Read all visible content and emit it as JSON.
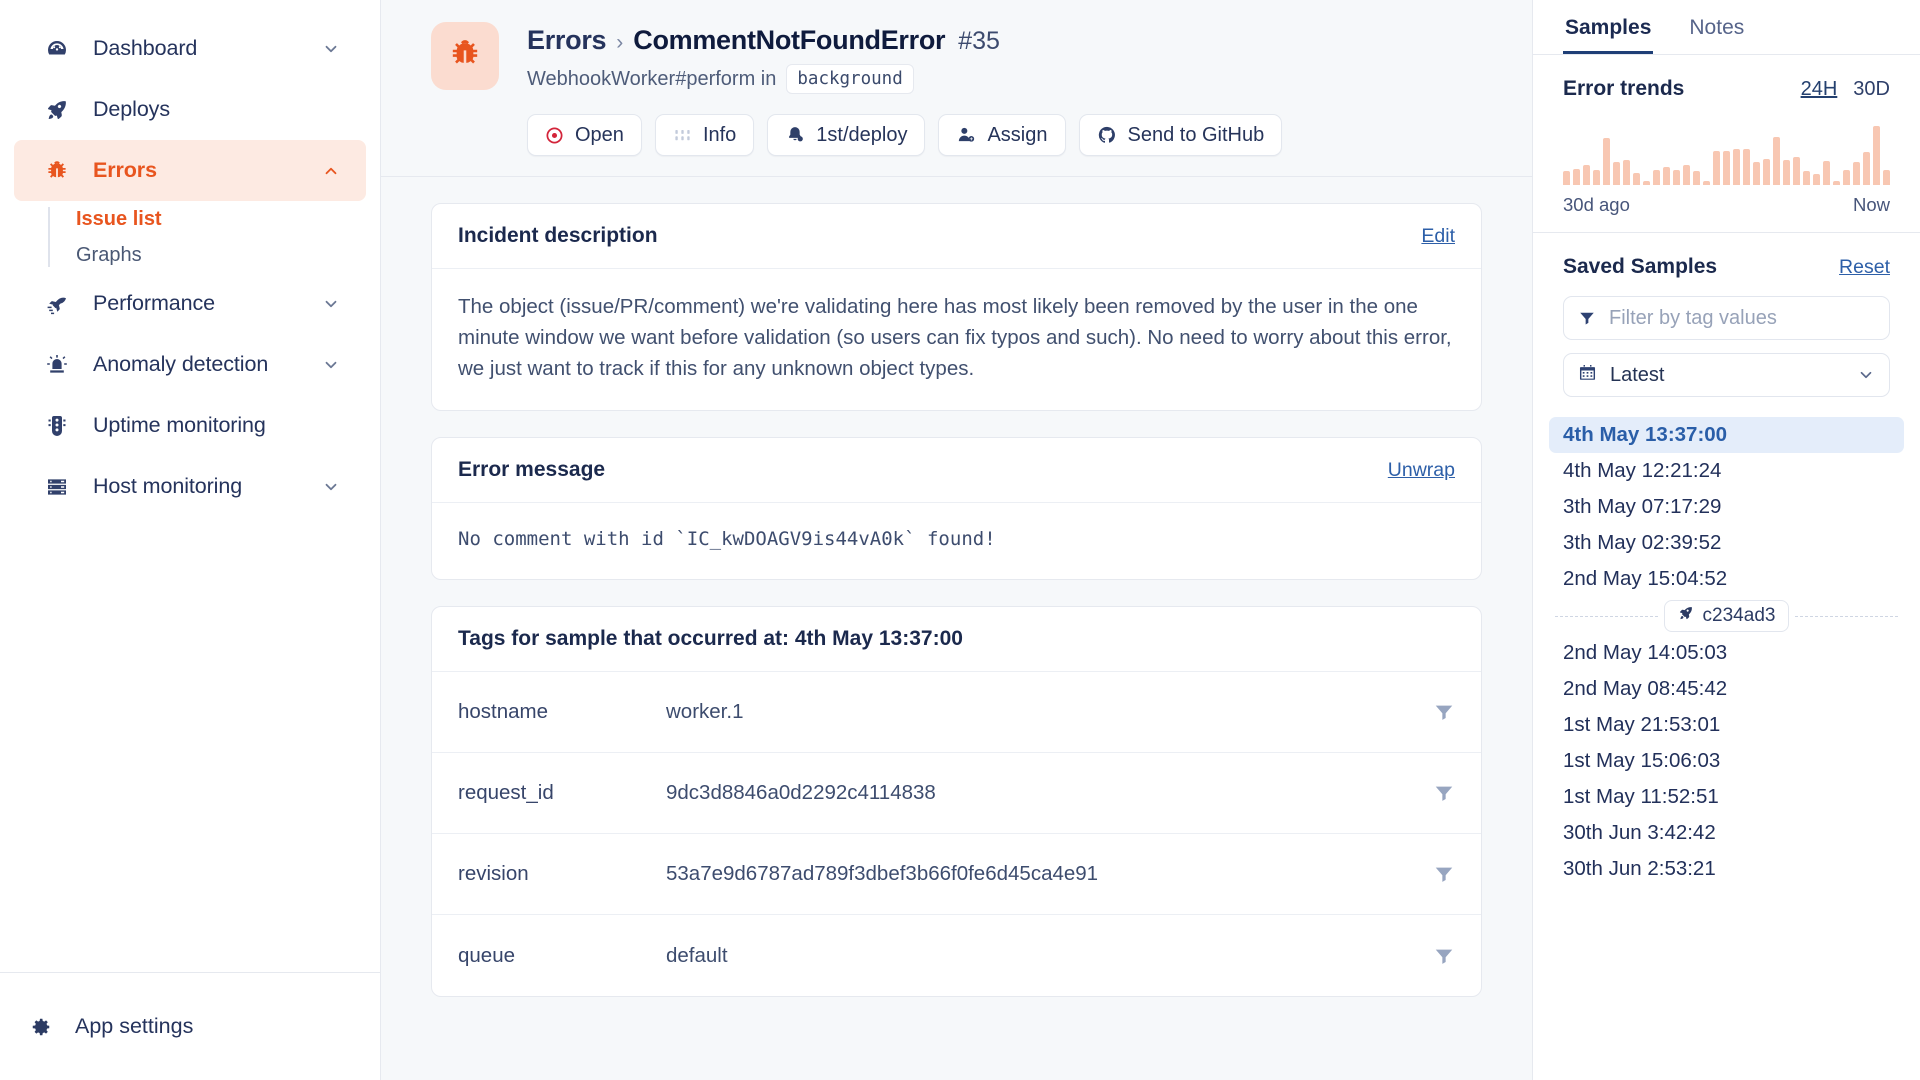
{
  "sidebar": {
    "items": [
      {
        "label": "Dashboard",
        "icon": "gauge-icon",
        "chevron": "down",
        "active": false
      },
      {
        "label": "Deploys",
        "icon": "rocket-icon",
        "chevron": "none",
        "active": false
      },
      {
        "label": "Errors",
        "icon": "bug-icon",
        "chevron": "up",
        "active": true
      },
      {
        "label": "Performance",
        "icon": "speed-icon",
        "chevron": "down",
        "active": false
      },
      {
        "label": "Anomaly detection",
        "icon": "siren-icon",
        "chevron": "down",
        "active": false
      },
      {
        "label": "Uptime monitoring",
        "icon": "traffic-light-icon",
        "chevron": "none",
        "active": false
      },
      {
        "label": "Host monitoring",
        "icon": "server-icon",
        "chevron": "down",
        "active": false
      }
    ],
    "subitems": [
      {
        "label": "Issue list",
        "active": true
      },
      {
        "label": "Graphs",
        "active": false
      }
    ],
    "footer": {
      "label": "App settings",
      "icon": "gear-icon"
    }
  },
  "header": {
    "badge_icon": "bug-icon",
    "breadcrumb_root": "Errors",
    "breadcrumb_sep": "›",
    "breadcrumb_current": "CommentNotFoundError",
    "issue_number": "#35",
    "location": "WebhookWorker#perform in",
    "context_chip": "background",
    "buttons": [
      {
        "label": "Open",
        "icon": "status-open-icon"
      },
      {
        "label": "Info",
        "icon": "bars-icon"
      },
      {
        "label": "1st/deploy",
        "icon": "bell-icon"
      },
      {
        "label": "Assign",
        "icon": "user-add-icon"
      },
      {
        "label": "Send to GitHub",
        "icon": "github-icon"
      }
    ]
  },
  "incident": {
    "title": "Incident description",
    "action": "Edit",
    "body": "The object (issue/PR/comment) we're validating here has most likely been removed by the user in the one minute window we want before validation (so users can fix typos and such). No need to worry about this error, we just want to track if this for any unknown object types."
  },
  "error_message": {
    "title": "Error message",
    "action": "Unwrap",
    "body": "No comment with id `IC_kwDOAGV9is44vA0k` found!"
  },
  "tags": {
    "title": "Tags for sample that occurred at: 4th May 13:37:00",
    "rows": [
      {
        "key": "hostname",
        "value": "worker.1"
      },
      {
        "key": "request_id",
        "value": "9dc3d8846a0d2292c4114838"
      },
      {
        "key": "revision",
        "value": "53a7e9d6787ad789f3dbef3b66f0fe6d45ca4e91"
      },
      {
        "key": "queue",
        "value": "default"
      }
    ],
    "filter_icon": "funnel-icon"
  },
  "right_panel": {
    "tabs": [
      {
        "label": "Samples",
        "active": true
      },
      {
        "label": "Notes",
        "active": false
      }
    ],
    "trends": {
      "title": "Error trends",
      "ranges": [
        {
          "label": "24H",
          "active": true
        },
        {
          "label": "30D",
          "active": false
        }
      ],
      "axis_left": "30d ago",
      "axis_right": "Now"
    },
    "saved": {
      "title": "Saved Samples",
      "reset_label": "Reset",
      "filter_placeholder": "Filter by tag values",
      "filter_value": "",
      "filter_icon": "funnel-icon",
      "sort_value": "Latest",
      "sort_icon": "calendar-icon",
      "samples_before": [
        {
          "time": "4th May 13:37:00",
          "selected": true
        },
        {
          "time": "4th May 12:21:24",
          "selected": false
        },
        {
          "time": "3th May 07:17:29",
          "selected": false
        },
        {
          "time": "3th May 02:39:52",
          "selected": false
        },
        {
          "time": "2nd May 15:04:52",
          "selected": false
        }
      ],
      "deploy_marker": {
        "label": "c234ad3",
        "icon": "rocket-icon"
      },
      "samples_after": [
        {
          "time": "2nd May 14:05:03",
          "selected": false
        },
        {
          "time": "2nd May 08:45:42",
          "selected": false
        },
        {
          "time": "1st May 21:53:01",
          "selected": false
        },
        {
          "time": "1st May 15:06:03",
          "selected": false
        },
        {
          "time": "1st May 11:52:51",
          "selected": false
        },
        {
          "time": "30th Jun 3:42:42",
          "selected": false
        },
        {
          "time": "30th Jun 2:53:21",
          "selected": false
        }
      ]
    }
  },
  "colors": {
    "accent_orange": "#e8551f",
    "accent_orange_bg": "#fdeae2",
    "spark_bar": "#f8c7b2",
    "link_blue": "#2d5fa8",
    "text_dark": "#1b294d",
    "selected_row_bg": "#e4edfa"
  },
  "chart_data": {
    "type": "bar",
    "title": "Error trends",
    "xlabel": "",
    "ylabel": "",
    "legend": [],
    "grid": false,
    "xticklabels": [
      "30d ago",
      "Now"
    ],
    "range_selected": "24H",
    "categories": [
      "1",
      "2",
      "3",
      "4",
      "5",
      "6",
      "7",
      "8",
      "9",
      "10",
      "11",
      "12",
      "13",
      "14",
      "15",
      "16",
      "17",
      "18",
      "19",
      "20",
      "21",
      "22",
      "23",
      "24",
      "25",
      "26",
      "27",
      "28",
      "29",
      "30",
      "31",
      "32",
      "33"
    ],
    "values": [
      12,
      14,
      18,
      13,
      42,
      20,
      22,
      11,
      4,
      13,
      16,
      13,
      18,
      12,
      4,
      30,
      30,
      32,
      32,
      20,
      23,
      43,
      22,
      25,
      12,
      10,
      21,
      4,
      13,
      20,
      29,
      52,
      13
    ],
    "ylim": [
      0,
      55
    ]
  }
}
